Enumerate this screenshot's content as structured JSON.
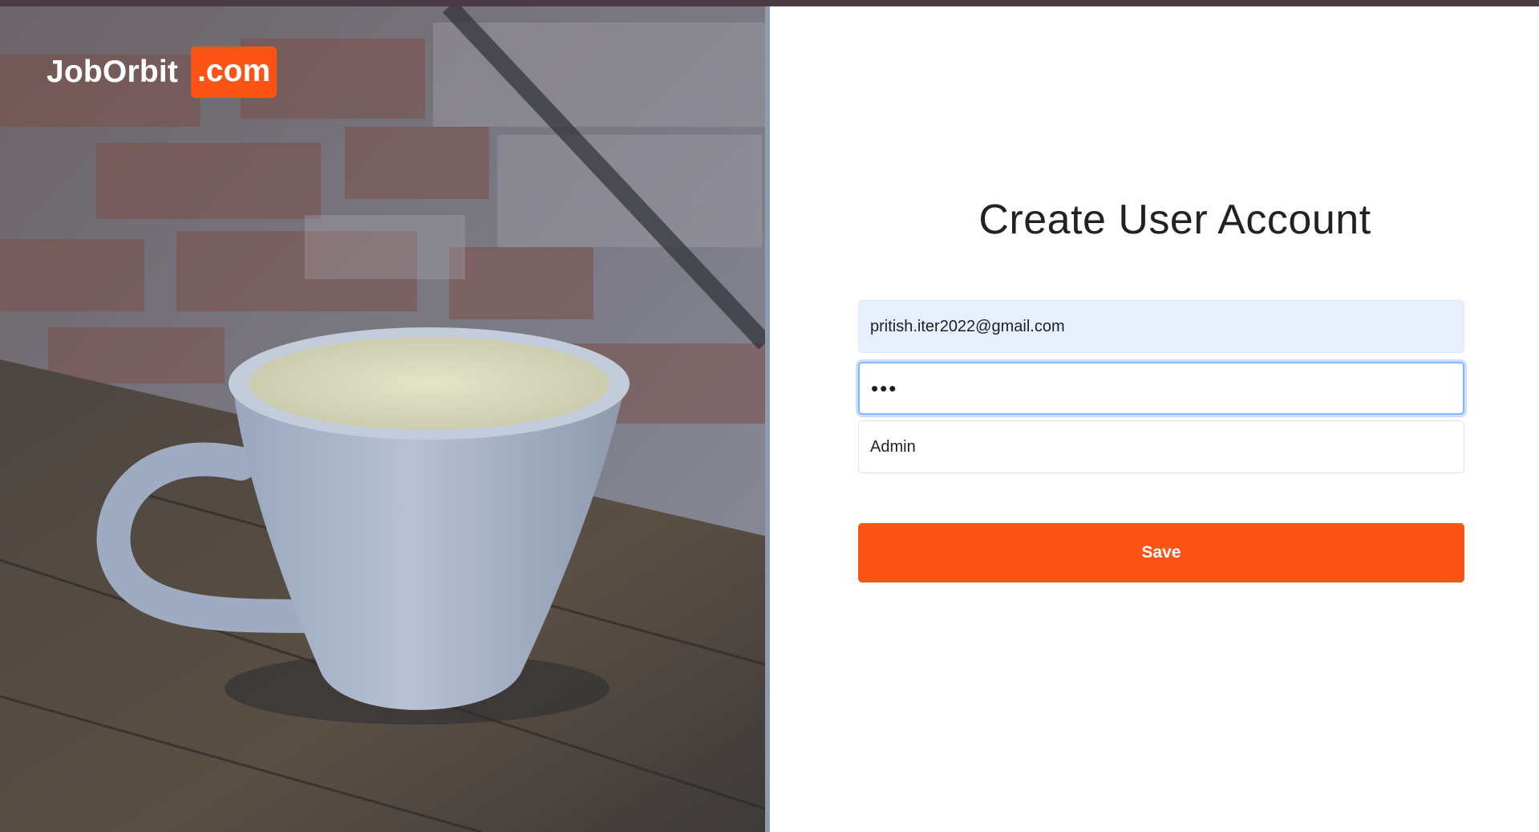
{
  "brand": {
    "name": "JobOrbit",
    "badge": ".com"
  },
  "form": {
    "title": "Create User Account",
    "email_value": "pritish.iter2022@gmail.com",
    "password_value": "•••",
    "role_value": "Admin",
    "save_label": "Save"
  },
  "colors": {
    "accent": "#fb5416",
    "topbar": "#4a3b42",
    "autofill_bg": "#e8f0fe",
    "focus_border": "#86b7fe"
  }
}
